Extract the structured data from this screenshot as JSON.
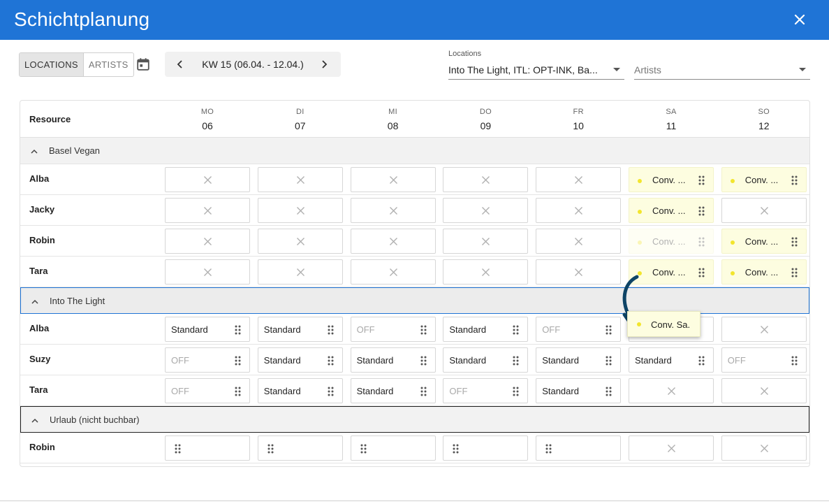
{
  "header": {
    "title": "Schichtplanung"
  },
  "toolbar": {
    "view_options": [
      "LOCATIONS",
      "ARTISTS"
    ],
    "active_view": "LOCATIONS",
    "week_label": "KW 15 (06.04. - 12.04.)"
  },
  "filters": {
    "locations_label": "Locations",
    "locations_value": "Into The Light, ITL: OPT-INK, Ba...",
    "artists_placeholder": "Artists"
  },
  "grid": {
    "resource_header": "Resource",
    "days": [
      {
        "name": "MO",
        "date": "06"
      },
      {
        "name": "DI",
        "date": "07"
      },
      {
        "name": "MI",
        "date": "08"
      },
      {
        "name": "DO",
        "date": "09"
      },
      {
        "name": "FR",
        "date": "10"
      },
      {
        "name": "SA",
        "date": "11"
      },
      {
        "name": "SO",
        "date": "12"
      }
    ],
    "groups": [
      {
        "name": "Basel Vegan",
        "rows": [
          {
            "name": "Alba",
            "cells": [
              {
                "type": "empty"
              },
              {
                "type": "empty"
              },
              {
                "type": "empty"
              },
              {
                "type": "empty"
              },
              {
                "type": "empty"
              },
              {
                "type": "shift",
                "label": "Conv. ..."
              },
              {
                "type": "shift",
                "label": "Conv. ..."
              }
            ]
          },
          {
            "name": "Jacky",
            "cells": [
              {
                "type": "empty"
              },
              {
                "type": "empty"
              },
              {
                "type": "empty"
              },
              {
                "type": "empty"
              },
              {
                "type": "empty"
              },
              {
                "type": "shift",
                "label": "Conv. ..."
              },
              {
                "type": "empty"
              }
            ]
          },
          {
            "name": "Robin",
            "cells": [
              {
                "type": "empty"
              },
              {
                "type": "empty"
              },
              {
                "type": "empty"
              },
              {
                "type": "empty"
              },
              {
                "type": "empty"
              },
              {
                "type": "shift-faded",
                "label": "Conv. ..."
              },
              {
                "type": "shift",
                "label": "Conv. ..."
              }
            ]
          },
          {
            "name": "Tara",
            "cells": [
              {
                "type": "empty"
              },
              {
                "type": "empty"
              },
              {
                "type": "empty"
              },
              {
                "type": "empty"
              },
              {
                "type": "empty"
              },
              {
                "type": "shift",
                "label": "Conv. ..."
              },
              {
                "type": "shift",
                "label": "Conv. ..."
              }
            ]
          }
        ]
      },
      {
        "name": "Into The Light",
        "rows": [
          {
            "name": "Alba",
            "cells": [
              {
                "type": "text",
                "label": "Standard"
              },
              {
                "type": "text",
                "label": "Standard"
              },
              {
                "type": "off",
                "label": "OFF"
              },
              {
                "type": "text",
                "label": "Standard"
              },
              {
                "type": "off",
                "label": "OFF"
              },
              {
                "type": "empty"
              },
              {
                "type": "empty"
              }
            ]
          },
          {
            "name": "Suzy",
            "cells": [
              {
                "type": "off",
                "label": "OFF"
              },
              {
                "type": "text",
                "label": "Standard"
              },
              {
                "type": "text",
                "label": "Standard"
              },
              {
                "type": "text",
                "label": "Standard"
              },
              {
                "type": "text",
                "label": "Standard"
              },
              {
                "type": "text",
                "label": "Standard"
              },
              {
                "type": "off",
                "label": "OFF"
              }
            ]
          },
          {
            "name": "Tara",
            "cells": [
              {
                "type": "off",
                "label": "OFF"
              },
              {
                "type": "text",
                "label": "Standard"
              },
              {
                "type": "text",
                "label": "Standard"
              },
              {
                "type": "off",
                "label": "OFF"
              },
              {
                "type": "text",
                "label": "Standard"
              },
              {
                "type": "empty"
              },
              {
                "type": "empty"
              }
            ]
          }
        ]
      },
      {
        "name": "Urlaub (nicht buchbar)",
        "rows": [
          {
            "name": "Robin",
            "cells": [
              {
                "type": "handle"
              },
              {
                "type": "handle"
              },
              {
                "type": "handle"
              },
              {
                "type": "handle"
              },
              {
                "type": "handle"
              },
              {
                "type": "empty"
              },
              {
                "type": "empty"
              }
            ]
          }
        ]
      }
    ]
  },
  "drag_preview": {
    "label": "Conv. Sa."
  }
}
